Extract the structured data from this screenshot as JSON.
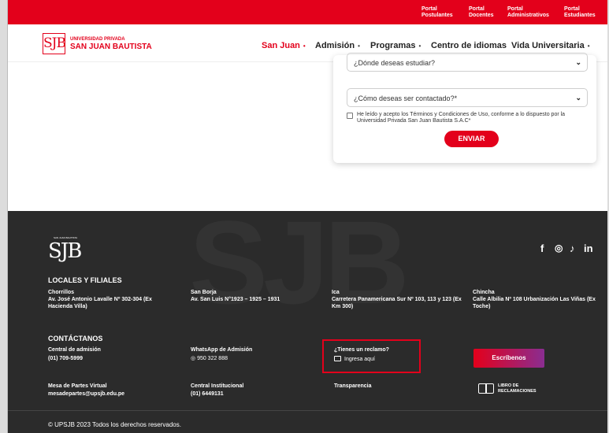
{
  "topbar": {
    "portals": [
      {
        "l1": "Portal",
        "l2": "Postulantes"
      },
      {
        "l1": "Portal",
        "l2": "Docentes"
      },
      {
        "l1": "Portal",
        "l2": "Administrativos"
      },
      {
        "l1": "Portal",
        "l2": "Estudiantes"
      }
    ]
  },
  "header": {
    "logo_mark": "SJB",
    "logo_line1": "UNIVERSIDAD PRIVADA",
    "logo_line2": "SAN JUAN BAUTISTA",
    "nav": [
      {
        "label": "San Juan",
        "caret": "•"
      },
      {
        "label": "Admisión",
        "caret": "•"
      },
      {
        "label": "Programas",
        "caret": "•"
      },
      {
        "label": "Centro de idiomas",
        "caret": ""
      },
      {
        "label": "Vida Universitaria",
        "caret": "•"
      }
    ]
  },
  "form": {
    "select1_value": "¿Dónde deseas estudiar?",
    "select2_value": "¿Cómo deseas ser contactado?*",
    "terms": "He leído y acepto los Términos y Condiciones de Uso, conforme a lo dispuesto por la Universidad Privada San Juan Bautista S.A.C*",
    "submit": "ENVIAR"
  },
  "footer": {
    "watermark": "SJB",
    "logo": "SJB",
    "logo_small": "SAN JUAN BAUTISTA",
    "social": [
      "f",
      "◎",
      "♪",
      "in"
    ],
    "locales_title": "LOCALES Y FILIALES",
    "locales": [
      {
        "name": "Chorrillos",
        "address": "Av. José Antonio Lavalle Nº 302-304 (Ex Hacienda Villa)"
      },
      {
        "name": "San Borja",
        "address": "Av. San Luis N°1923 – 1925 – 1931"
      },
      {
        "name": "Ica",
        "address": "Carretera Panamericana Sur Nº 103, 113 y 123 (Ex Km 300)"
      },
      {
        "name": "Chincha",
        "address": "Calle Albilia Nº 108 Urbanización Las Viñas (Ex Toche)"
      }
    ],
    "contact_title": "CONTÁCTANOS",
    "contacts": {
      "central_admision": {
        "label": "Central de admisión",
        "value": "(01) 709-5999"
      },
      "whatsapp": {
        "label": "WhatsApp de Admisión",
        "value": "950 322 888"
      },
      "reclamo": {
        "label": "¿Tienes un reclamo?",
        "value": "Ingresa aquí"
      },
      "escribenos": "Escríbenos",
      "mesa": {
        "label": "Mesa de Partes Virtual",
        "value": "mesadepartes@upsjb.edu.pe"
      },
      "central_inst": {
        "label": "Central Institucional",
        "value": "(01) 6449131"
      },
      "transparencia": "Transparencia",
      "libro_l1": "LIBRO DE",
      "libro_l2": "RECLAMACIONES"
    },
    "copyright": "© UPSJB 2023 Todos los derechos reservados."
  },
  "colors": {
    "brand_red": "#e3001b",
    "footer_bg": "#2b2b2b",
    "gradient_end": "#8a2d91"
  }
}
